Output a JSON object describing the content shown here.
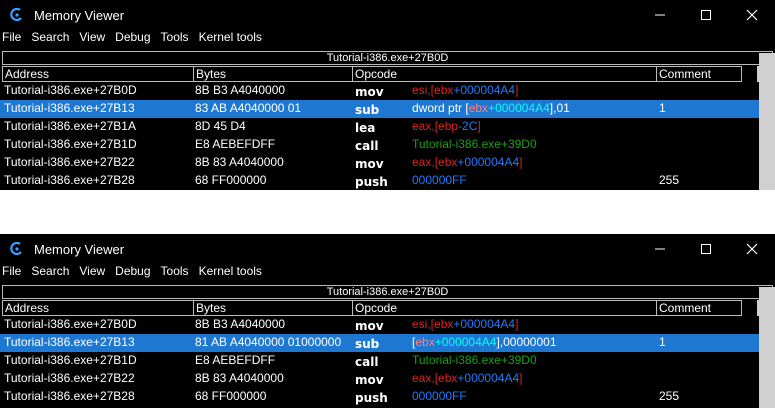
{
  "window1": {
    "title": "Memory Viewer",
    "menu": [
      "File",
      "Search",
      "View",
      "Debug",
      "Tools",
      "Kernel tools"
    ],
    "address_bar": "Tutorial-i386.exe+27B0D",
    "headers": {
      "address": "Address",
      "bytes": "Bytes",
      "opcode": "Opcode",
      "comment": "Comment"
    },
    "rows": [
      {
        "address": "Tutorial-i386.exe+27B0D",
        "bytes": "8B B3 A4040000",
        "opcode": "mov",
        "args": [
          {
            "t": "esi",
            "c": "red"
          },
          {
            "t": ",[",
            "c": "red"
          },
          {
            "t": "ebx",
            "c": "red"
          },
          {
            "t": "+000004A4",
            "c": "blue"
          },
          {
            "t": "]",
            "c": "red"
          }
        ],
        "comment": ""
      },
      {
        "address": "Tutorial-i386.exe+27B13",
        "bytes": "83 AB A4040000 01",
        "opcode": "sub",
        "args": [
          {
            "t": "dword ptr [",
            "c": "white"
          },
          {
            "t": "ebx",
            "c": "red"
          },
          {
            "t": "+000004A4",
            "c": "blue"
          },
          {
            "t": "],01",
            "c": "white"
          }
        ],
        "comment": "1",
        "selected": true
      },
      {
        "address": "Tutorial-i386.exe+27B1A",
        "bytes": "8D 45 D4",
        "opcode": "lea",
        "args": [
          {
            "t": "eax",
            "c": "red"
          },
          {
            "t": ",[",
            "c": "red"
          },
          {
            "t": "ebp",
            "c": "red"
          },
          {
            "t": "-2C",
            "c": "blue"
          },
          {
            "t": "]",
            "c": "red"
          }
        ],
        "comment": ""
      },
      {
        "address": "Tutorial-i386.exe+27B1D",
        "bytes": "E8 AEBEFDFF",
        "opcode": "call",
        "args": [
          {
            "t": "Tutorial-i386.exe+39D0",
            "c": "green"
          }
        ],
        "comment": ""
      },
      {
        "address": "Tutorial-i386.exe+27B22",
        "bytes": "8B 83 A4040000",
        "opcode": "mov",
        "args": [
          {
            "t": "eax",
            "c": "red"
          },
          {
            "t": ",[",
            "c": "red"
          },
          {
            "t": "ebx",
            "c": "red"
          },
          {
            "t": "+000004A4",
            "c": "blue"
          },
          {
            "t": "]",
            "c": "red"
          }
        ],
        "comment": ""
      },
      {
        "address": "Tutorial-i386.exe+27B28",
        "bytes": "68 FF000000",
        "opcode": "push",
        "args": [
          {
            "t": "000000FF",
            "c": "blue"
          }
        ],
        "comment": "255"
      }
    ]
  },
  "window2": {
    "title": "Memory Viewer",
    "menu": [
      "File",
      "Search",
      "View",
      "Debug",
      "Tools",
      "Kernel tools"
    ],
    "address_bar": "Tutorial-i386.exe+27B0D",
    "headers": {
      "address": "Address",
      "bytes": "Bytes",
      "opcode": "Opcode",
      "comment": "Comment"
    },
    "rows": [
      {
        "address": "Tutorial-i386.exe+27B0D",
        "bytes": "8B B3 A4040000",
        "opcode": "mov",
        "args": [
          {
            "t": "esi",
            "c": "red"
          },
          {
            "t": ",[",
            "c": "red"
          },
          {
            "t": "ebx",
            "c": "red"
          },
          {
            "t": "+000004A4",
            "c": "blue"
          },
          {
            "t": "]",
            "c": "red"
          }
        ],
        "comment": ""
      },
      {
        "address": "Tutorial-i386.exe+27B13",
        "bytes": "81 AB A4040000 01000000",
        "opcode": "sub",
        "args": [
          {
            "t": "[",
            "c": "white"
          },
          {
            "t": "ebx",
            "c": "red"
          },
          {
            "t": "+000004A4",
            "c": "blue"
          },
          {
            "t": "],00000001",
            "c": "white"
          }
        ],
        "comment": "1",
        "selected": true
      },
      {
        "address": "Tutorial-i386.exe+27B1D",
        "bytes": "E8 AEBEFDFF",
        "opcode": "call",
        "args": [
          {
            "t": "Tutorial-i386.exe+39D0",
            "c": "green"
          }
        ],
        "comment": ""
      },
      {
        "address": "Tutorial-i386.exe+27B22",
        "bytes": "8B 83 A4040000",
        "opcode": "mov",
        "args": [
          {
            "t": "eax",
            "c": "red"
          },
          {
            "t": ",[",
            "c": "red"
          },
          {
            "t": "ebx",
            "c": "red"
          },
          {
            "t": "+000004A4",
            "c": "blue"
          },
          {
            "t": "]",
            "c": "red"
          }
        ],
        "comment": ""
      },
      {
        "address": "Tutorial-i386.exe+27B28",
        "bytes": "68 FF000000",
        "opcode": "push",
        "args": [
          {
            "t": "000000FF",
            "c": "blue"
          }
        ],
        "comment": "255"
      }
    ]
  },
  "icons": {
    "app": "cheat-engine-icon",
    "minimize": "minimize-icon",
    "maximize": "maximize-icon",
    "close": "close-icon"
  }
}
